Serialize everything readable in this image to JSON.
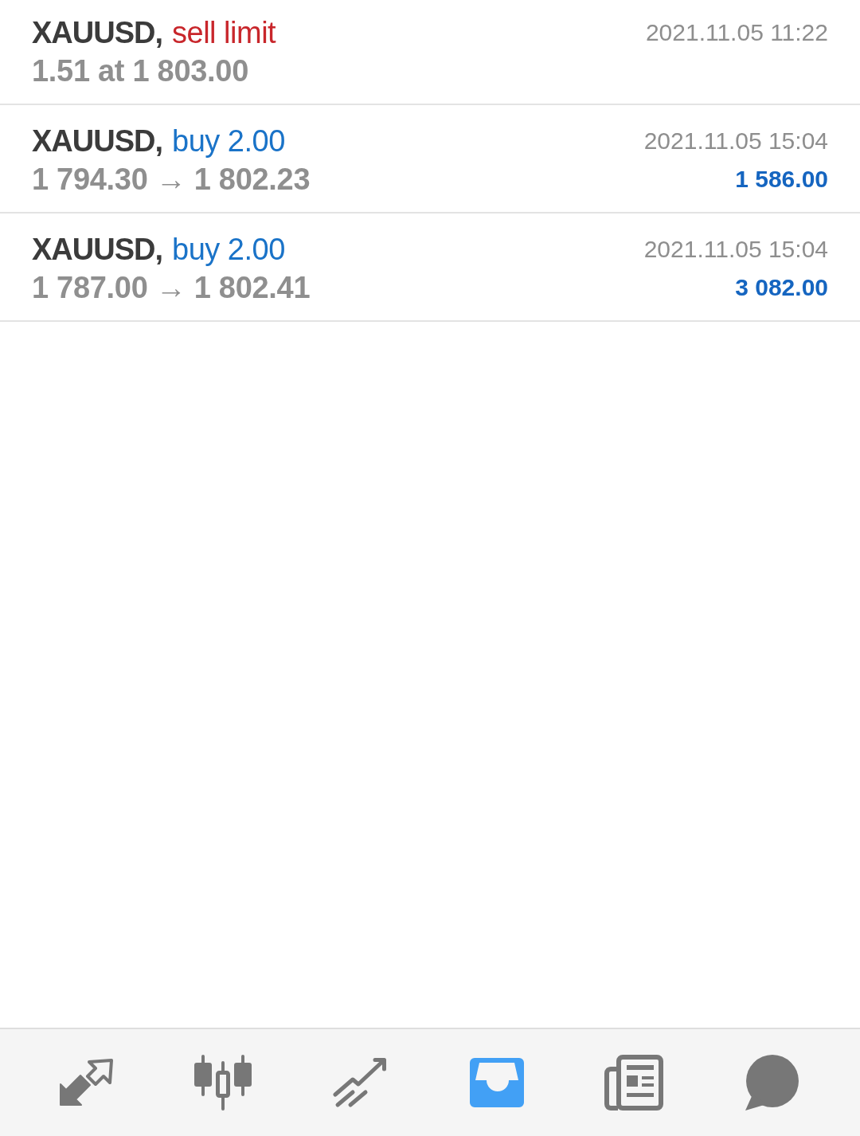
{
  "orders": [
    {
      "symbol": "XAUUSD,",
      "action": "sell limit",
      "kind": "sell",
      "details": "1.51 at 1 803.00",
      "time": "2021.11.05 11:22"
    },
    {
      "symbol": "XAUUSD,",
      "action": "buy 2.00",
      "kind": "buy",
      "details": "1 794.30 → 1 802.23",
      "time": "2021.11.05 15:04",
      "profit": "1 586.00"
    },
    {
      "symbol": "XAUUSD,",
      "action": "buy 2.00",
      "kind": "buy",
      "details": "1 787.00 → 1 802.41",
      "time": "2021.11.05 15:04",
      "profit": "3 082.00"
    }
  ],
  "nav": [
    {
      "kind": "arrows",
      "selected": false
    },
    {
      "kind": "candles",
      "selected": false
    },
    {
      "kind": "trend",
      "selected": false
    },
    {
      "kind": "inbox",
      "selected": true
    },
    {
      "kind": "document",
      "selected": false
    },
    {
      "kind": "bubble",
      "selected": false
    }
  ]
}
